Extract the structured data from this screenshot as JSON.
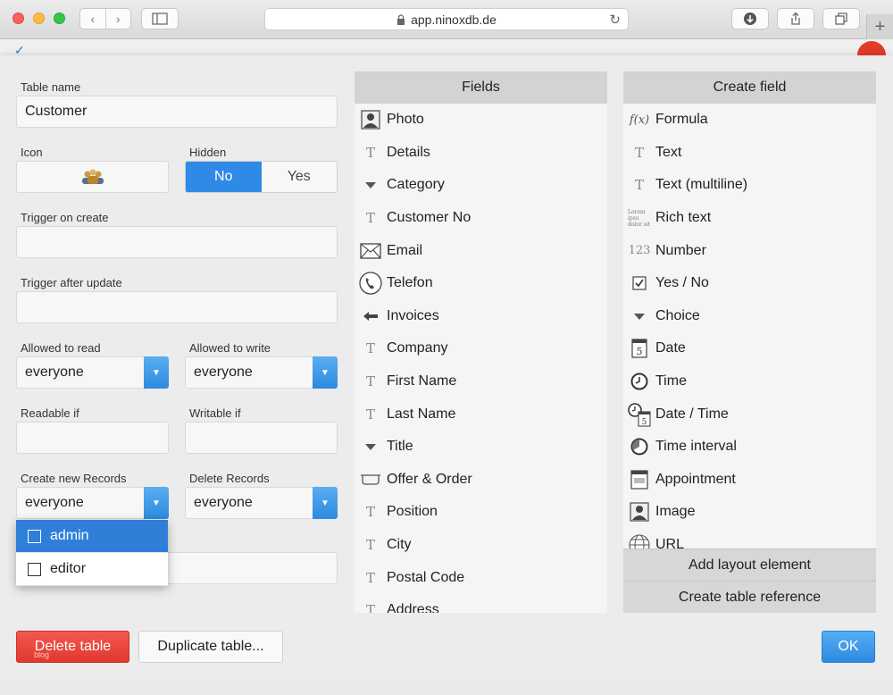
{
  "browser": {
    "url": "app.ninoxdb.de"
  },
  "form": {
    "table_name_label": "Table name",
    "table_name_value": "Customer",
    "icon_label": "Icon",
    "hidden_label": "Hidden",
    "hidden_no": "No",
    "hidden_yes": "Yes",
    "trigger_create_label": "Trigger on create",
    "trigger_update_label": "Trigger after update",
    "allowed_read_label": "Allowed to read",
    "allowed_read_value": "everyone",
    "allowed_write_label": "Allowed to write",
    "allowed_write_value": "everyone",
    "readable_if_label": "Readable if",
    "writable_if_label": "Writable if",
    "create_records_label": "Create new Records",
    "create_records_value": "everyone",
    "delete_records_label": "Delete Records",
    "delete_records_value": "everyone"
  },
  "dropdown": {
    "options": [
      "admin",
      "editor"
    ]
  },
  "fields": {
    "header": "Fields",
    "items": [
      {
        "label": "Photo",
        "icon": "photo-icon"
      },
      {
        "label": "Details",
        "icon": "text-icon"
      },
      {
        "label": "Category",
        "icon": "choice-icon"
      },
      {
        "label": "Customer No",
        "icon": "text-icon"
      },
      {
        "label": "Email",
        "icon": "email-icon"
      },
      {
        "label": "Telefon",
        "icon": "phone-icon"
      },
      {
        "label": "Invoices",
        "icon": "reference-icon"
      },
      {
        "label": "Company",
        "icon": "text-icon"
      },
      {
        "label": "First Name",
        "icon": "text-icon"
      },
      {
        "label": "Last Name",
        "icon": "text-icon"
      },
      {
        "label": "Title",
        "icon": "choice-icon"
      },
      {
        "label": "Offer & Order",
        "icon": "tray-icon"
      },
      {
        "label": "Position",
        "icon": "text-icon"
      },
      {
        "label": "City",
        "icon": "text-icon"
      },
      {
        "label": "Postal Code",
        "icon": "text-icon"
      },
      {
        "label": "Address",
        "icon": "text-icon"
      }
    ]
  },
  "create": {
    "header": "Create field",
    "items": [
      {
        "label": "Formula",
        "icon": "formula-icon"
      },
      {
        "label": "Text",
        "icon": "text-icon"
      },
      {
        "label": "Text (multiline)",
        "icon": "text-icon"
      },
      {
        "label": "Rich text",
        "icon": "rich-text-icon"
      },
      {
        "label": "Number",
        "icon": "number-icon"
      },
      {
        "label": "Yes / No",
        "icon": "checkbox-icon"
      },
      {
        "label": "Choice",
        "icon": "choice-icon"
      },
      {
        "label": "Date",
        "icon": "calendar-icon"
      },
      {
        "label": "Time",
        "icon": "clock-icon"
      },
      {
        "label": "Date / Time",
        "icon": "datetime-icon"
      },
      {
        "label": "Time interval",
        "icon": "interval-icon"
      },
      {
        "label": "Appointment",
        "icon": "appointment-icon"
      },
      {
        "label": "Image",
        "icon": "photo-icon"
      },
      {
        "label": "URL",
        "icon": "globe-icon"
      }
    ],
    "add_layout": "Add layout element",
    "create_reference": "Create table reference"
  },
  "buttons": {
    "delete": "Delete table",
    "duplicate": "Duplicate table...",
    "ok": "OK"
  },
  "watermark": "blog",
  "glyphs": {
    "text": "T",
    "formula": "f(x)",
    "number": "123",
    "rich": "Lorem ipsu dolor sit",
    "check": "✓",
    "down": "▼",
    "back": "‹",
    "fwd": "›",
    "reload": "↻",
    "lock": "🔒",
    "plus": "+",
    "sidebar": "▭"
  },
  "colors": {
    "accent": "#2f8ae6",
    "danger": "#e0392f",
    "header_bg": "#d3d3d3"
  }
}
